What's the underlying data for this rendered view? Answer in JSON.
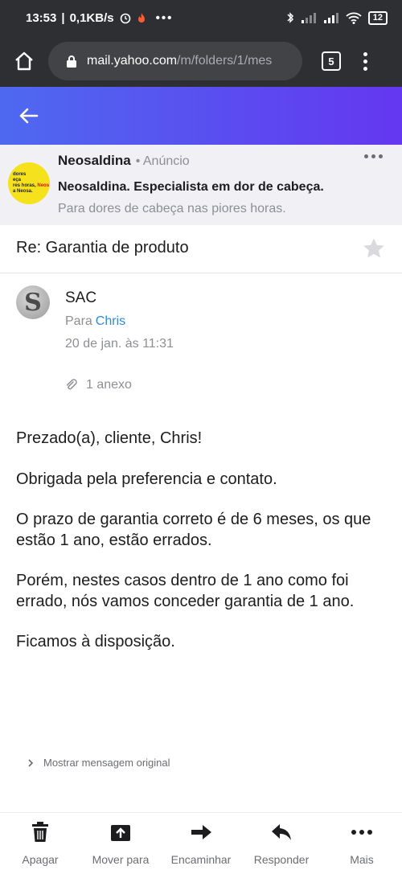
{
  "status_bar": {
    "time": "13:53",
    "network_speed": "0,1KB/s",
    "battery": "12"
  },
  "browser": {
    "url_domain": "mail.yahoo.com",
    "url_path": "/m/folders/1/mes",
    "tab_count": "5"
  },
  "ad": {
    "brand": "Neosaldina",
    "tag": "• Anúncio",
    "headline": "Neosaldina. Especialista em dor de cabeça.",
    "description": "Para dores de cabeça nas piores horas.",
    "logo_text_1": "dores",
    "logo_text_2": "eça",
    "logo_text_3": "res horas,",
    "logo_text_4": "a Neosa.",
    "logo_brand_1": "Neo",
    "logo_brand_2": "Neos"
  },
  "message": {
    "subject": "Re: Garantia de produto",
    "sender": "SAC",
    "avatar_letter": "S",
    "to_label": "Para",
    "recipient": "Chris",
    "date": "20 de jan. às 11:31",
    "attachments": "1 anexo",
    "body": [
      "Prezado(a), cliente, Chris!",
      "Obrigada pela preferencia e contato.",
      "O prazo de garantia correto é de 6 meses, os que estão 1 ano, estão errados.",
      "Porém, nestes casos dentro de 1 ano como foi errado, nós vamos conceder garantia de 1 ano.",
      "Ficamos à disposição."
    ],
    "show_original": "Mostrar mensagem original"
  },
  "actions": [
    {
      "label": "Apagar",
      "icon": "trash-icon"
    },
    {
      "label": "Mover para",
      "icon": "move-to-folder-icon"
    },
    {
      "label": "Encaminhar",
      "icon": "forward-icon"
    },
    {
      "label": "Responder",
      "icon": "reply-icon"
    },
    {
      "label": "Mais",
      "icon": "more-icon"
    }
  ],
  "colors": {
    "header_gradient_start": "#4e69f0",
    "header_gradient_end": "#6437f0",
    "link": "#2f8bd8",
    "ad_background": "#f0f0f5",
    "logo_yellow": "#f6e21c"
  }
}
